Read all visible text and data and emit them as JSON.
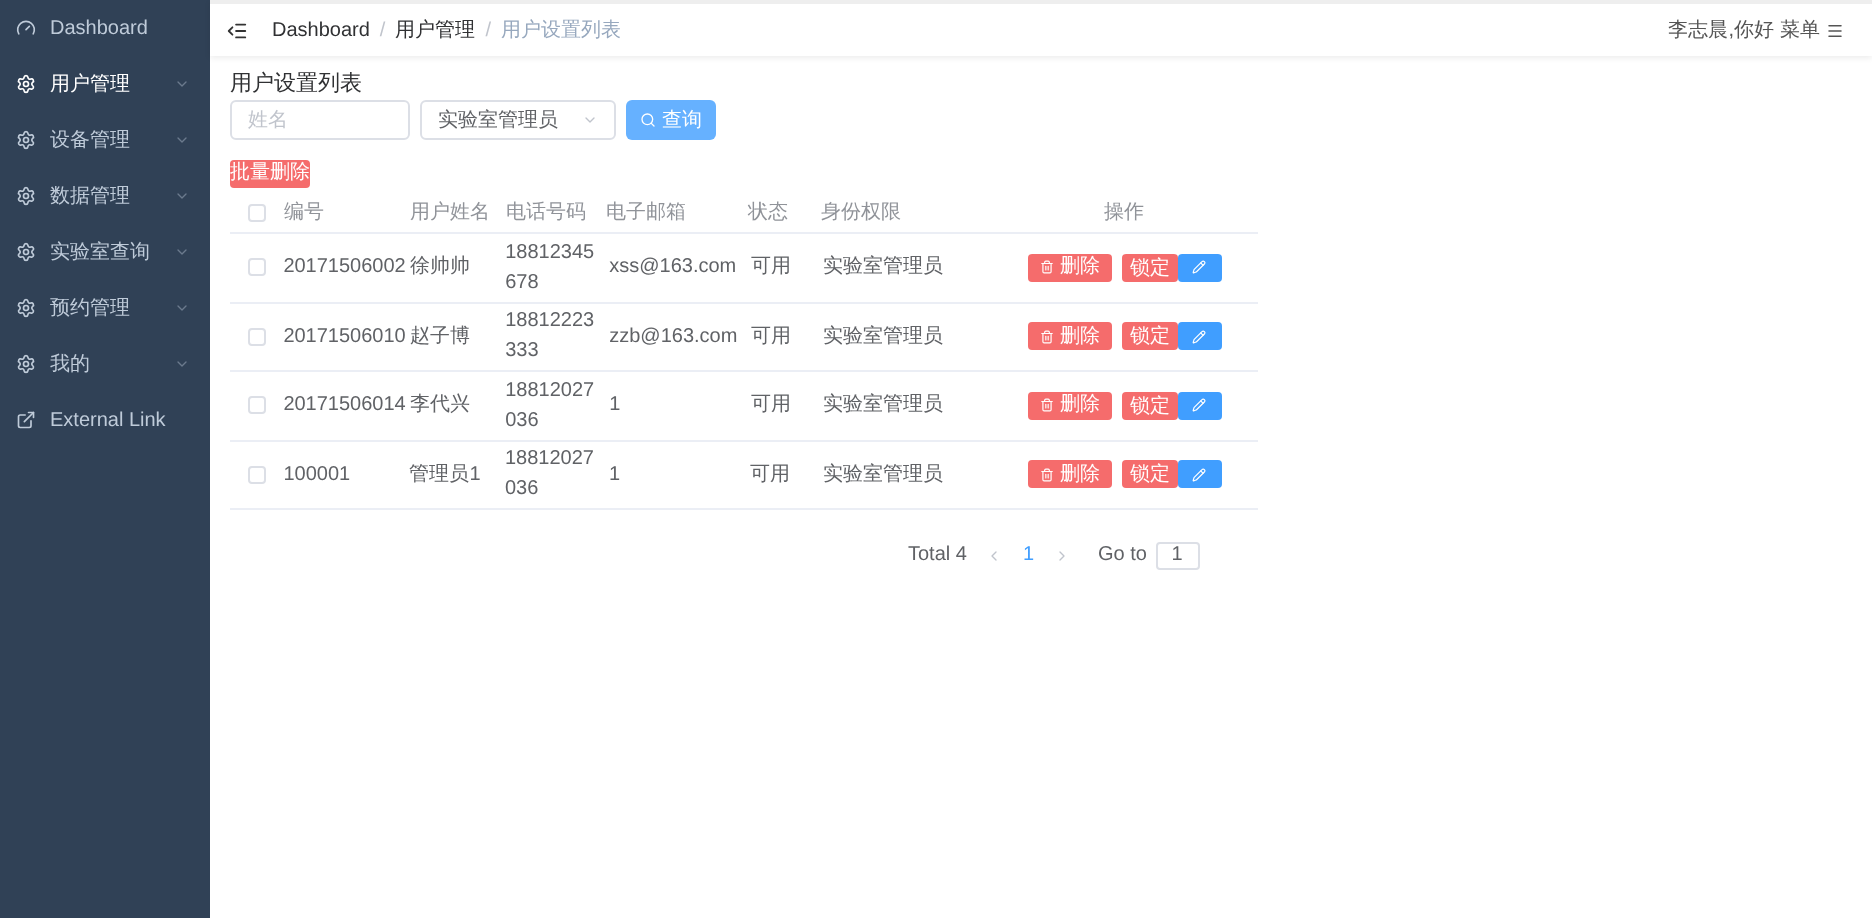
{
  "sidebar": {
    "items": [
      {
        "label": "Dashboard",
        "kind": "dashboard",
        "expandable": false,
        "selected": false
      },
      {
        "label": "用户管理",
        "kind": "menu",
        "expandable": true,
        "selected": true
      },
      {
        "label": "设备管理",
        "kind": "menu",
        "expandable": true,
        "selected": false
      },
      {
        "label": "数据管理",
        "kind": "menu",
        "expandable": true,
        "selected": false
      },
      {
        "label": "实验室查询",
        "kind": "menu",
        "expandable": true,
        "selected": false
      },
      {
        "label": "预约管理",
        "kind": "menu",
        "expandable": true,
        "selected": false
      },
      {
        "label": "我的",
        "kind": "menu",
        "expandable": true,
        "selected": false
      },
      {
        "label": "External Link",
        "kind": "link",
        "expandable": false,
        "selected": false
      }
    ]
  },
  "breadcrumb": [
    {
      "label": "Dashboard"
    },
    {
      "separator": "/",
      "label": "用户管理"
    },
    {
      "separator": "/",
      "label": "用户设置列表"
    }
  ],
  "user_menu": {
    "greeting": "李志晨,你好",
    "menu": "菜单"
  },
  "page_title": "用户设置列表",
  "filters": {
    "name": {
      "placeholder": "姓名"
    },
    "role": {
      "value": "实验室管理员"
    },
    "search_button": "查询"
  },
  "batch_delete_button": "批量删除",
  "table": {
    "select_all_checked": false,
    "columns": [
      "编号",
      "用户姓名",
      "电话号码",
      "电子邮箱",
      "状态",
      "身份权限",
      "操作"
    ],
    "rows": [
      {
        "checked": false,
        "cells": [
          "20171506002",
          "徐帅帅",
          "18812345678",
          "xss@163.com",
          "可用",
          "实验室管理员"
        ],
        "delete": "删除",
        "lock": "锁定"
      },
      {
        "checked": false,
        "cells": [
          "20171506010",
          "赵子博",
          "18812223333",
          "zzb@163.com",
          "可用",
          "实验室管理员"
        ],
        "delete": "删除",
        "lock": "锁定"
      },
      {
        "checked": false,
        "cells": [
          "20171506014",
          "李代兴",
          "18812027036",
          "1",
          "可用",
          "实验室管理员"
        ],
        "delete": "删除",
        "lock": "锁定"
      },
      {
        "checked": false,
        "cells": [
          "100001",
          "管理员1",
          "18812027036",
          "1",
          "可用",
          "实验室管理员"
        ],
        "delete": "删除",
        "lock": "锁定"
      }
    ]
  },
  "pagination": {
    "total": "Total 4",
    "pages": [
      {
        "label": "1",
        "selected": true
      }
    ],
    "goto_label": "Go to",
    "goto_value": "1"
  }
}
